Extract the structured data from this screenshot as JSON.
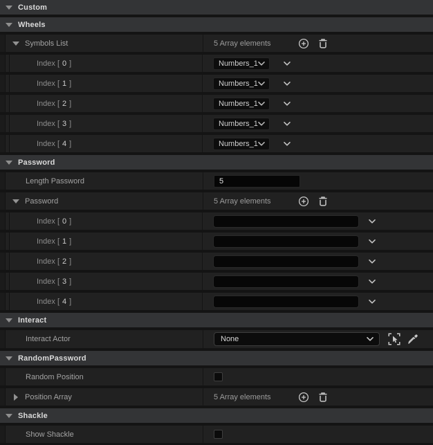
{
  "colors": {
    "panel_background": "#141414",
    "category_header_bg": "#333436",
    "row_bg": "#212121",
    "input_bg": "#0b0b0b",
    "header_text": "#dadada",
    "label_text": "#a3a3a3",
    "value_text": "#cfcfcf"
  },
  "rows": [
    {
      "type": "category",
      "label": "Custom"
    },
    {
      "type": "category",
      "label": "Wheels"
    },
    {
      "type": "array-header",
      "label": "Symbols List",
      "count": "5 Array elements",
      "expanded": true
    },
    {
      "type": "enum-item",
      "prefix": "Index [",
      "num": "0",
      "suffix": "]",
      "value": "Numbers_1"
    },
    {
      "type": "enum-item",
      "prefix": "Index [",
      "num": "1",
      "suffix": "]",
      "value": "Numbers_1"
    },
    {
      "type": "enum-item",
      "prefix": "Index [",
      "num": "2",
      "suffix": "]",
      "value": "Numbers_1"
    },
    {
      "type": "enum-item",
      "prefix": "Index [",
      "num": "3",
      "suffix": "]",
      "value": "Numbers_1"
    },
    {
      "type": "enum-item",
      "prefix": "Index [",
      "num": "4",
      "suffix": "]",
      "value": "Numbers_1"
    },
    {
      "type": "category",
      "label": "Password"
    },
    {
      "type": "text-prop",
      "label": "Length Password",
      "value": "5"
    },
    {
      "type": "array-header",
      "label": "Password",
      "count": "5 Array elements",
      "expanded": true
    },
    {
      "type": "text-item",
      "prefix": "Index [",
      "num": "0",
      "suffix": "]",
      "value": ""
    },
    {
      "type": "text-item",
      "prefix": "Index [",
      "num": "1",
      "suffix": "]",
      "value": ""
    },
    {
      "type": "text-item",
      "prefix": "Index [",
      "num": "2",
      "suffix": "]",
      "value": ""
    },
    {
      "type": "text-item",
      "prefix": "Index [",
      "num": "3",
      "suffix": "]",
      "value": ""
    },
    {
      "type": "text-item",
      "prefix": "Index [",
      "num": "4",
      "suffix": "]",
      "value": ""
    },
    {
      "type": "category",
      "label": "Interact"
    },
    {
      "type": "object-prop",
      "label": "Interact Actor",
      "value": "None"
    },
    {
      "type": "category",
      "label": "RandomPassword"
    },
    {
      "type": "bool-prop",
      "label": "Random Position",
      "checked": false
    },
    {
      "type": "array-header",
      "label": "Position Array",
      "count": "5 Array elements",
      "expanded": false
    },
    {
      "type": "category",
      "label": "Shackle"
    },
    {
      "type": "bool-prop",
      "label": "Show Shackle",
      "checked": false
    }
  ]
}
